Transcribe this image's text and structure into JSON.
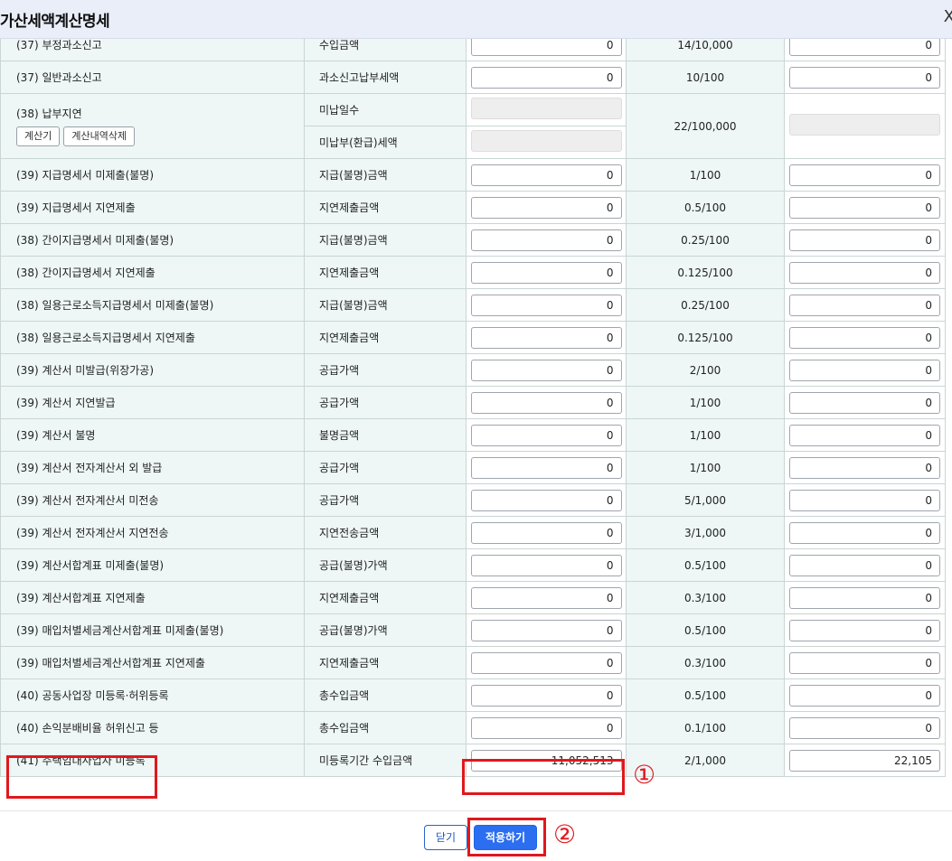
{
  "dialog": {
    "title": "가산세액계산명세",
    "close_glyph": "X"
  },
  "rows": [
    {
      "label": "(37) 부정과소신고",
      "base": "수입금액",
      "amount": "0",
      "rate": "14/10,000",
      "result": "0",
      "partial": true
    },
    {
      "label": "(37) 일반과소신고",
      "base": "과소신고납부세액",
      "amount": "0",
      "rate": "10/100",
      "result": "0"
    },
    {
      "label": "(38) 납부지연",
      "base": "미납일수",
      "base2": "미납부(환급)세액",
      "rate": "22/100,000",
      "buttons": [
        "계산기",
        "계산내역삭제"
      ],
      "special": true
    },
    {
      "label": "(39) 지급명세서 미제출(불명)",
      "base": "지급(불명)금액",
      "amount": "0",
      "rate": "1/100",
      "result": "0"
    },
    {
      "label": "(39) 지급명세서 지연제출",
      "base": "지연제출금액",
      "amount": "0",
      "rate": "0.5/100",
      "result": "0"
    },
    {
      "label": "(38) 간이지급명세서 미제출(불명)",
      "base": "지급(불명)금액",
      "amount": "0",
      "rate": "0.25/100",
      "result": "0"
    },
    {
      "label": "(38) 간이지급명세서 지연제출",
      "base": "지연제출금액",
      "amount": "0",
      "rate": "0.125/100",
      "result": "0"
    },
    {
      "label": "(38) 일용근로소득지급명세서 미제출(불명)",
      "base": "지급(불명)금액",
      "amount": "0",
      "rate": "0.25/100",
      "result": "0"
    },
    {
      "label": "(38) 일용근로소득지급명세서 지연제출",
      "base": "지연제출금액",
      "amount": "0",
      "rate": "0.125/100",
      "result": "0"
    },
    {
      "label": "(39) 계산서 미발급(위장가공)",
      "base": "공급가액",
      "amount": "0",
      "rate": "2/100",
      "result": "0"
    },
    {
      "label": "(39) 계산서 지연발급",
      "base": "공급가액",
      "amount": "0",
      "rate": "1/100",
      "result": "0"
    },
    {
      "label": "(39) 계산서 불명",
      "base": "불명금액",
      "amount": "0",
      "rate": "1/100",
      "result": "0"
    },
    {
      "label": "(39) 계산서 전자계산서 외 발급",
      "base": "공급가액",
      "amount": "0",
      "rate": "1/100",
      "result": "0"
    },
    {
      "label": "(39) 계산서 전자계산서 미전송",
      "base": "공급가액",
      "amount": "0",
      "rate": "5/1,000",
      "result": "0"
    },
    {
      "label": "(39) 계산서 전자계산서 지연전송",
      "base": "지연전송금액",
      "amount": "0",
      "rate": "3/1,000",
      "result": "0"
    },
    {
      "label": "(39) 계산서합계표 미제출(불명)",
      "base": "공급(불명)가액",
      "amount": "0",
      "rate": "0.5/100",
      "result": "0"
    },
    {
      "label": "(39) 계산서합계표 지연제출",
      "base": "지연제출금액",
      "amount": "0",
      "rate": "0.3/100",
      "result": "0"
    },
    {
      "label": "(39) 매입처별세금계산서합계표 미제출(불명)",
      "base": "공급(불명)가액",
      "amount": "0",
      "rate": "0.5/100",
      "result": "0"
    },
    {
      "label": "(39) 매입처별세금계산서합계표 지연제출",
      "base": "지연제출금액",
      "amount": "0",
      "rate": "0.3/100",
      "result": "0"
    },
    {
      "label": "(40) 공동사업장 미등록·허위등록",
      "base": "총수입금액",
      "amount": "0",
      "rate": "0.5/100",
      "result": "0"
    },
    {
      "label": "(40) 손익분배비율 허위신고 등",
      "base": "총수입금액",
      "amount": "0",
      "rate": "0.1/100",
      "result": "0"
    },
    {
      "label": "(41) 주택임대사업자 미등록",
      "base": "미등록기간 수입금액",
      "amount": "11,052,513",
      "rate": "2/1,000",
      "result": "22,105",
      "highlight": true
    }
  ],
  "annotations": {
    "marker1": "①",
    "marker2": "②",
    "highlight_color": "#e0181c"
  },
  "footer": {
    "close_label": "닫기",
    "apply_label": "적용하기"
  },
  "colors": {
    "label_bg": "#eef6f6",
    "border": "#c9d6d4",
    "apply_bg": "#2b6ef0",
    "title_bg": "#e9eef8"
  }
}
